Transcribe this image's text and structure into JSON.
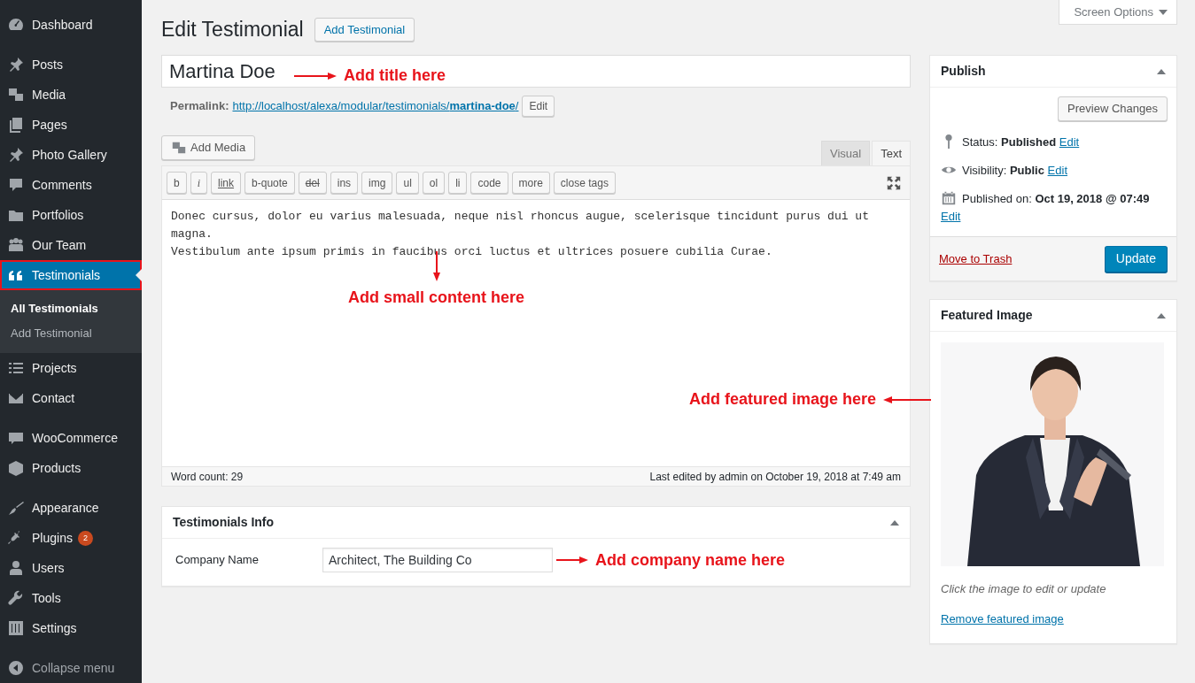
{
  "sidebar": {
    "groups": [
      {
        "items": [
          {
            "label": "Dashboard",
            "selected": false
          }
        ]
      },
      {
        "items": [
          {
            "label": "Posts",
            "selected": false
          },
          {
            "label": "Media",
            "selected": false
          },
          {
            "label": "Pages",
            "selected": false
          },
          {
            "label": "Photo Gallery",
            "selected": false
          },
          {
            "label": "Comments",
            "selected": false
          },
          {
            "label": "Portfolios",
            "selected": false
          },
          {
            "label": "Our Team",
            "selected": false
          },
          {
            "label": "Testimonials",
            "selected": true,
            "children": [
              {
                "label": "All Testimonials",
                "selected": true
              },
              {
                "label": "Add Testimonial",
                "selected": false
              }
            ]
          },
          {
            "label": "Projects",
            "selected": false
          },
          {
            "label": "Contact",
            "selected": false
          }
        ]
      },
      {
        "items": [
          {
            "label": "WooCommerce",
            "selected": false
          },
          {
            "label": "Products",
            "selected": false
          }
        ]
      },
      {
        "items": [
          {
            "label": "Appearance",
            "selected": false
          },
          {
            "label": "Plugins",
            "selected": false,
            "badge": "2"
          },
          {
            "label": "Users",
            "selected": false
          },
          {
            "label": "Tools",
            "selected": false
          },
          {
            "label": "Settings",
            "selected": false
          }
        ]
      }
    ],
    "collapse_label": "Collapse menu"
  },
  "screen_options": "Screen Options",
  "page_title": "Edit Testimonial",
  "add_new_button": "Add Testimonial",
  "title_field": {
    "value": "Martina Doe",
    "annotation": "Add title here"
  },
  "permalink": {
    "label": "Permalink:",
    "url": "http://localhost/alexa/modular/testimonials/**martina-doe**/",
    "edit_button": "Edit"
  },
  "editor": {
    "add_media_button": "Add Media",
    "tabs": [
      {
        "label": "Visual",
        "selected": false
      },
      {
        "label": "Text",
        "selected": true
      }
    ],
    "toolbar": [
      {
        "label": "b",
        "kind": "plain"
      },
      {
        "label": "i",
        "kind": "italic"
      },
      {
        "label": "link",
        "kind": "underline"
      },
      {
        "label": "b-quote",
        "kind": "plain"
      },
      {
        "label": "del",
        "kind": "strike"
      },
      {
        "label": "ins",
        "kind": "plain"
      },
      {
        "label": "img",
        "kind": "plain"
      },
      {
        "label": "ul",
        "kind": "plain"
      },
      {
        "label": "ol",
        "kind": "plain"
      },
      {
        "label": "li",
        "kind": "plain"
      },
      {
        "label": "code",
        "kind": "plain"
      },
      {
        "label": "more",
        "kind": "plain"
      },
      {
        "label": "close tags",
        "kind": "plain"
      }
    ],
    "content": "Donec cursus, dolor eu varius malesuada, neque nisl rhoncus augue, scelerisque tincidunt purus dui ut magna.\nVestibulum ante ipsum primis in faucibus orci luctus et ultrices posuere cubilia Curae.",
    "annotation": "Add small content here",
    "word_count": "Word count: 29",
    "last_edited": "Last edited by admin on October 19, 2018 at 7:49 am"
  },
  "testimonials_info": {
    "title": "Testimonials Info",
    "expanded": true,
    "fields": [
      {
        "label": "Company Name",
        "value": "Architect, The Building Co"
      }
    ],
    "annotation": "Add company name here"
  },
  "publish": {
    "title": "Publish",
    "expanded": true,
    "preview_button": "Preview Changes",
    "rows": [
      {
        "label": "Status:",
        "value": "Published",
        "link": "Edit"
      },
      {
        "label": "Visibility:",
        "value": "Public",
        "link": "Edit"
      },
      {
        "label": "Published on:",
        "value": "Oct 19, 2018 @ 07:49",
        "link": "Edit"
      }
    ],
    "trash_link": "Move to Trash",
    "update_button": "Update"
  },
  "featured_image": {
    "title": "Featured Image",
    "expanded": true,
    "hint": "Click the image to edit or update",
    "remove_link": "Remove featured image",
    "annotation": "Add featured image here"
  }
}
